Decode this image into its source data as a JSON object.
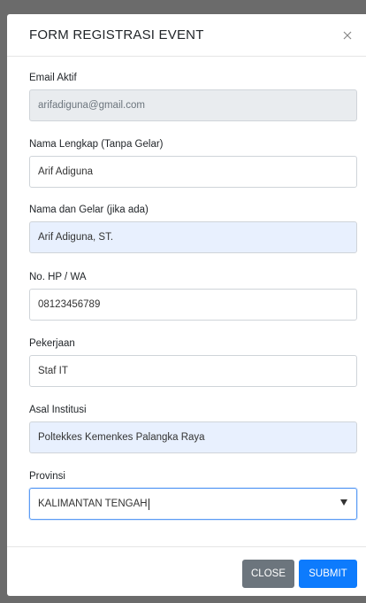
{
  "modal": {
    "title": "FORM REGISTRASI EVENT",
    "close_icon": "close-icon"
  },
  "fields": {
    "email": {
      "label": "Email Aktif",
      "value": "arifadiguna@gmail.com"
    },
    "full_name": {
      "label": "Nama Lengkap (Tanpa Gelar)",
      "value": "Arif Adiguna"
    },
    "name_title": {
      "label": "Nama dan Gelar (jika ada)",
      "value": "Arif Adiguna, ST."
    },
    "phone": {
      "label": "No. HP / WA",
      "value": "08123456789"
    },
    "job": {
      "label": "Pekerjaan",
      "value": "Staf IT"
    },
    "institution": {
      "label": "Asal Institusi",
      "value": "Poltekkes Kemenkes Palangka Raya"
    },
    "province": {
      "label": "Provinsi",
      "value": "KALIMANTAN TENGAH"
    }
  },
  "footer": {
    "close_label": "CLOSE",
    "submit_label": "SUBMIT"
  },
  "colors": {
    "backdrop": "#6b6b6b",
    "submit": "#0d7bfd",
    "close": "#6c757d",
    "readonly_bg": "#e9ecef",
    "autofill_bg": "#e8f0fe"
  }
}
